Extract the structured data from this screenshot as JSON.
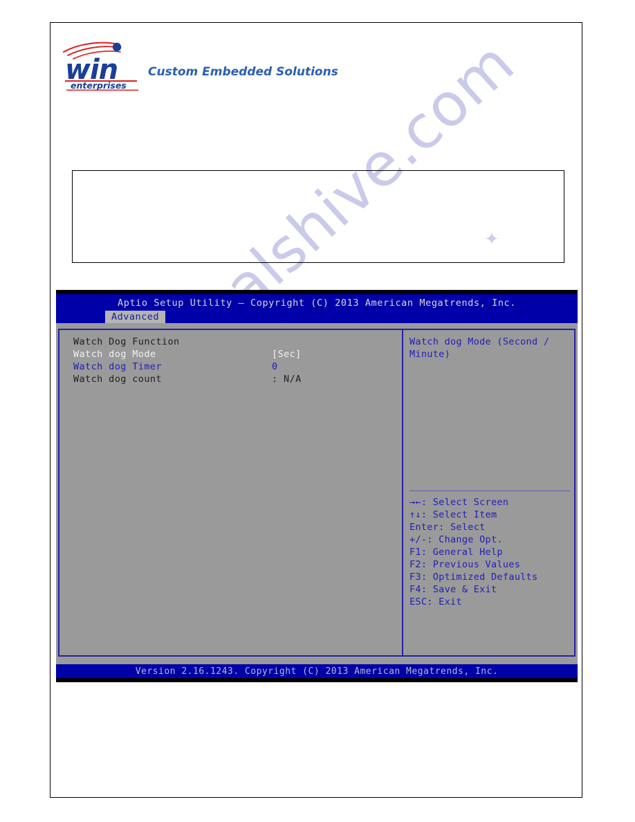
{
  "logo": {
    "brand_top": "win",
    "brand_bottom": "enterprises",
    "tagline": "Custom Embedded Solutions",
    "brand_blue": "#1a3f99",
    "brand_red": "#d92b2b",
    "tagline_color": "#2a5fb4"
  },
  "watermark": {
    "text": "manualshive.com",
    "color": "#9a9ad8"
  },
  "content_box": {
    "text": ""
  },
  "bios": {
    "title": "Aptio Setup Utility – Copyright (C) 2013 American Megatrends, Inc.",
    "tabs": [
      {
        "label": "Advanced",
        "active": true
      }
    ],
    "active_tab_label": "Advanced",
    "colors": {
      "title_bar": "#0000a8",
      "body": "#9a9a9a",
      "panel_border": "#2222a8",
      "highlight_text": "#2020b8",
      "normal_text": "#f0f0f0",
      "dim_text": "#20201e"
    },
    "menu": {
      "section_title": "Watch Dog Function",
      "items": [
        {
          "label": "Watch dog Mode",
          "value": "[Sec]",
          "style": "normal",
          "selected": false
        },
        {
          "label": "Watch dog Timer",
          "value": "0",
          "style": "selected",
          "selected": true
        },
        {
          "label": "Watch dog count",
          "value": ": N/A",
          "style": "dim",
          "selected": false
        }
      ]
    },
    "help": {
      "text": "Watch dog Mode (Second / Minute)"
    },
    "keys": [
      {
        "key": "→←",
        "action": ": Select Screen"
      },
      {
        "key": "↑↓",
        "action": ": Select Item"
      },
      {
        "key": "Enter",
        "action": ": Select"
      },
      {
        "key": "+/-",
        "action": ": Change Opt."
      },
      {
        "key": "F1",
        "action": ": General Help"
      },
      {
        "key": "F2",
        "action": ": Previous Values"
      },
      {
        "key": "F3",
        "action": ": Optimized Defaults"
      },
      {
        "key": "F4",
        "action": ": Save & Exit"
      },
      {
        "key": "ESC",
        "action": ": Exit"
      }
    ],
    "key_lines": [
      "→←: Select Screen",
      "↑↓: Select Item",
      "Enter: Select",
      "+/-: Change Opt.",
      "F1: General Help",
      "F2: Previous Values",
      "F3: Optimized Defaults",
      "F4: Save & Exit",
      "ESC: Exit"
    ],
    "footer": "Version 2.16.1243. Copyright (C) 2013 American Megatrends, Inc."
  }
}
